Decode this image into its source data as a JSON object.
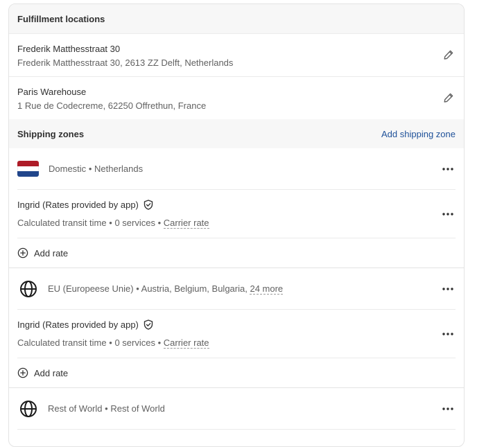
{
  "fulfillment": {
    "header": "Fulfillment locations",
    "locations": [
      {
        "name": "Frederik Matthesstraat 30",
        "address": "Frederik Matthesstraat 30, 2613 ZZ Delft, Netherlands"
      },
      {
        "name": "Paris Warehouse",
        "address": "1 Rue de Codecreme, 62250 Offrethun, France"
      }
    ]
  },
  "shipping": {
    "header": "Shipping zones",
    "add_zone_label": "Add shipping zone",
    "zones": [
      {
        "name": "Domestic",
        "countries": "Netherlands"
      },
      {
        "name": "EU (Europeese Unie)",
        "countries": "Austria, Belgium, Bulgaria,",
        "more": "24 more"
      },
      {
        "name": "Rest of World",
        "countries": "Rest of World"
      }
    ],
    "rate": {
      "title": "Ingrid (Rates provided by app)",
      "transit": "Calculated transit time",
      "services": "0 services",
      "carrier": "Carrier rate"
    },
    "add_rate_label": "Add rate",
    "separator": "•"
  },
  "colors": {
    "link": "#1f5199",
    "flag_red": "#ae1c28",
    "flag_white": "#ffffff",
    "flag_blue": "#21468b"
  }
}
